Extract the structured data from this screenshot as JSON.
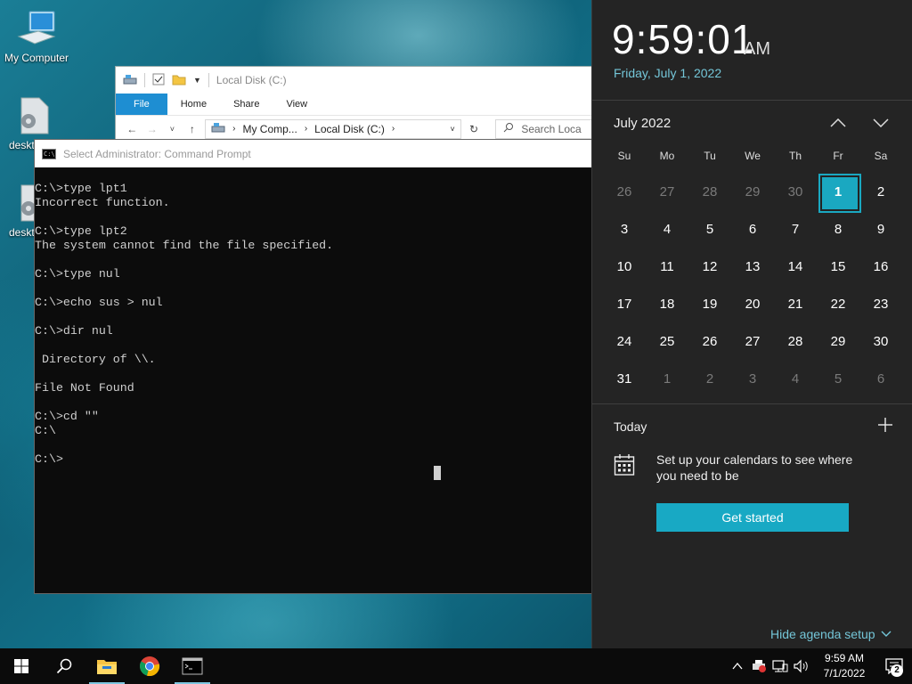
{
  "desktop": {
    "icons": [
      {
        "label": "My Computer"
      },
      {
        "label": "deskt"
      },
      {
        "label": "deskt"
      }
    ]
  },
  "explorer": {
    "title": "Local Disk (C:)",
    "ribbon_tabs": [
      "File",
      "Home",
      "Share",
      "View"
    ],
    "breadcrumb": [
      "My Comp...",
      "Local Disk (C:)"
    ],
    "search_placeholder": "Search Loca"
  },
  "cmd": {
    "title": "Select Administrator: Command Prompt",
    "lines": [
      "C:\\>type lpt1",
      "Incorrect function.",
      "",
      "C:\\>type lpt2",
      "The system cannot find the file specified.",
      "",
      "C:\\>type nul",
      "",
      "C:\\>echo sus > nul",
      "",
      "C:\\>dir nul",
      "",
      " Directory of \\\\.",
      "",
      "File Not Found",
      "",
      "C:\\>cd \"\"",
      "C:\\",
      "",
      "C:\\>"
    ]
  },
  "flyout": {
    "time": "9:59:01",
    "ampm": "AM",
    "date": "Friday, July 1, 2022",
    "month": "July 2022",
    "weekdays": [
      "Su",
      "Mo",
      "Tu",
      "We",
      "Th",
      "Fr",
      "Sa"
    ],
    "days": [
      {
        "n": "26",
        "other": true
      },
      {
        "n": "27",
        "other": true
      },
      {
        "n": "28",
        "other": true
      },
      {
        "n": "29",
        "other": true
      },
      {
        "n": "30",
        "other": true
      },
      {
        "n": "1",
        "today": true
      },
      {
        "n": "2"
      },
      {
        "n": "3"
      },
      {
        "n": "4"
      },
      {
        "n": "5"
      },
      {
        "n": "6"
      },
      {
        "n": "7"
      },
      {
        "n": "8"
      },
      {
        "n": "9"
      },
      {
        "n": "10"
      },
      {
        "n": "11"
      },
      {
        "n": "12"
      },
      {
        "n": "13"
      },
      {
        "n": "14"
      },
      {
        "n": "15"
      },
      {
        "n": "16"
      },
      {
        "n": "17"
      },
      {
        "n": "18"
      },
      {
        "n": "19"
      },
      {
        "n": "20"
      },
      {
        "n": "21"
      },
      {
        "n": "22"
      },
      {
        "n": "23"
      },
      {
        "n": "24"
      },
      {
        "n": "25"
      },
      {
        "n": "26"
      },
      {
        "n": "27"
      },
      {
        "n": "28"
      },
      {
        "n": "29"
      },
      {
        "n": "30"
      },
      {
        "n": "31"
      },
      {
        "n": "1",
        "other": true
      },
      {
        "n": "2",
        "other": true
      },
      {
        "n": "3",
        "other": true
      },
      {
        "n": "4",
        "other": true
      },
      {
        "n": "5",
        "other": true
      },
      {
        "n": "6",
        "other": true
      }
    ],
    "today_label": "Today",
    "agenda_message": "Set up your calendars to see where you need to be",
    "get_started": "Get started",
    "hide_agenda": "Hide agenda setup"
  },
  "taskbar": {
    "apps": [
      {
        "icon": "search-icon"
      },
      {
        "icon": "file-explorer-icon"
      },
      {
        "icon": "chrome-icon"
      },
      {
        "icon": "command-prompt-icon"
      }
    ],
    "tray_time": "9:59 AM",
    "tray_date": "7/1/2022",
    "notification_count": "2"
  },
  "colors": {
    "accent": "#18a9c4",
    "link": "#74c6d8",
    "flyout_bg": "#242424",
    "console_bg": "#0c0c0c"
  }
}
